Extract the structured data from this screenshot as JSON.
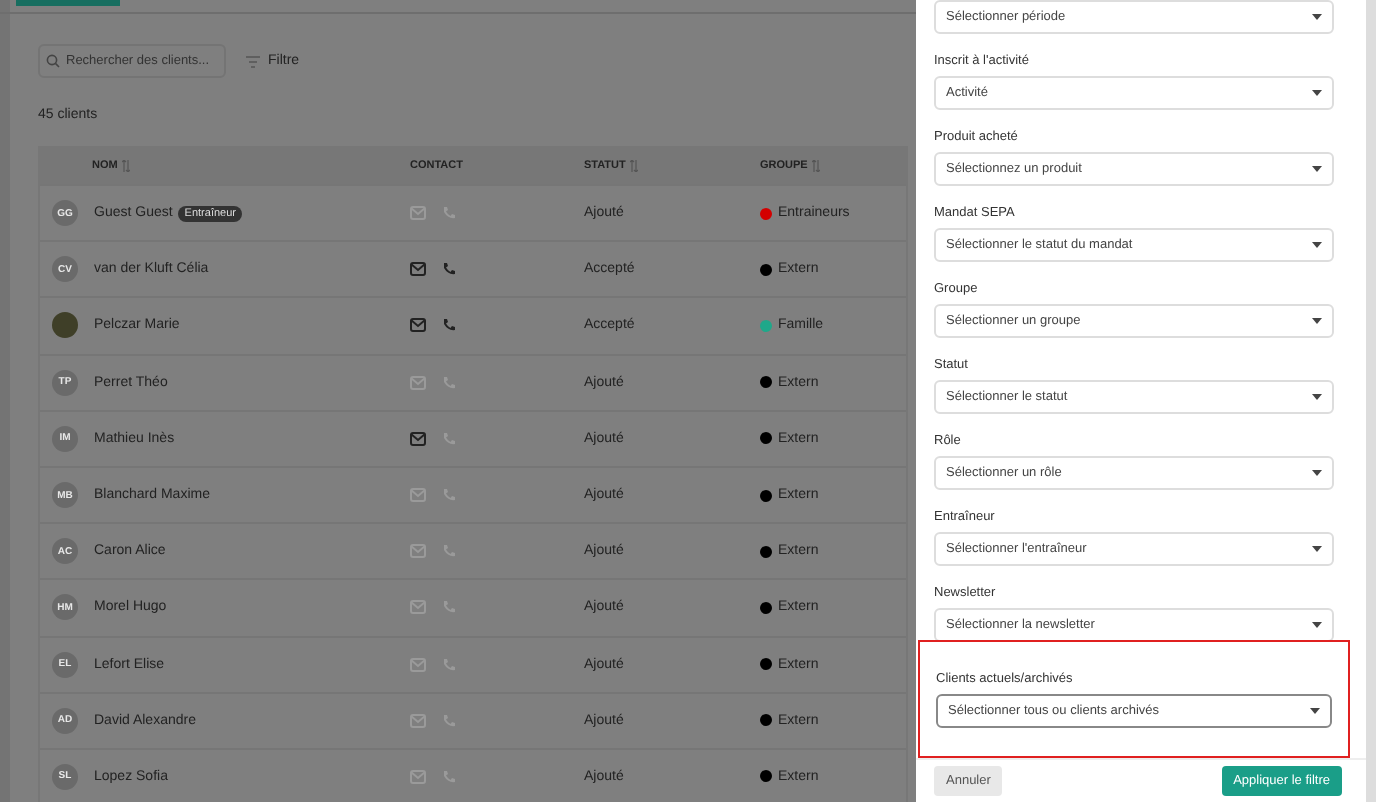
{
  "search": {
    "placeholder": "Rechercher des clients..."
  },
  "filter_button": {
    "label": "Filtre"
  },
  "client_count": "45 clients",
  "table": {
    "columns": [
      {
        "label": "NOM",
        "sortable": true
      },
      {
        "label": "CONTACT",
        "sortable": false
      },
      {
        "label": "STATUT",
        "sortable": true
      },
      {
        "label": "GROUPE",
        "sortable": true
      }
    ],
    "rows": [
      {
        "initials": "GG",
        "photo": false,
        "name": "Guest Guest",
        "badge": "Entraîneur",
        "email": false,
        "phone": false,
        "status": "Ajouté",
        "group": "Entraineurs",
        "color": "#d40000"
      },
      {
        "initials": "CV",
        "photo": false,
        "name": "van der Kluft Célia",
        "email": true,
        "phone": true,
        "status": "Accepté",
        "group": "Extern",
        "color": "#000000"
      },
      {
        "photo": true,
        "name": "Pelczar Marie",
        "email": true,
        "phone": true,
        "status": "Accepté",
        "group": "Famille",
        "color": "#1fa88a"
      },
      {
        "initials": "TP",
        "photo": false,
        "name": "Perret Théo",
        "email": false,
        "phone": false,
        "status": "Ajouté",
        "group": "Extern",
        "color": "#000000"
      },
      {
        "initials": "IM",
        "photo": false,
        "name": "Mathieu Inès",
        "email": true,
        "phone": false,
        "status": "Ajouté",
        "group": "Extern",
        "color": "#000000"
      },
      {
        "initials": "MB",
        "photo": false,
        "name": "Blanchard Maxime",
        "email": false,
        "phone": false,
        "status": "Ajouté",
        "group": "Extern",
        "color": "#000000"
      },
      {
        "initials": "AC",
        "photo": false,
        "name": "Caron Alice",
        "email": false,
        "phone": false,
        "status": "Ajouté",
        "group": "Extern",
        "color": "#000000"
      },
      {
        "initials": "HM",
        "photo": false,
        "name": "Morel Hugo",
        "email": false,
        "phone": false,
        "status": "Ajouté",
        "group": "Extern",
        "color": "#000000"
      },
      {
        "initials": "EL",
        "photo": false,
        "name": "Lefort Elise",
        "email": false,
        "phone": false,
        "status": "Ajouté",
        "group": "Extern",
        "color": "#000000"
      },
      {
        "initials": "AD",
        "photo": false,
        "name": "David Alexandre",
        "email": false,
        "phone": false,
        "status": "Ajouté",
        "group": "Extern",
        "color": "#000000"
      },
      {
        "initials": "SL",
        "photo": false,
        "name": "Lopez Sofia",
        "email": false,
        "phone": false,
        "status": "Ajouté",
        "group": "Extern",
        "color": "#000000"
      }
    ]
  },
  "filter_panel": {
    "fields": [
      {
        "value": "Sélectionner période",
        "highlighted": false
      },
      {
        "label": "Inscrit à l'activité",
        "value": "Activité",
        "highlighted": false
      },
      {
        "label": "Produit acheté",
        "value": "Sélectionnez un produit",
        "highlighted": false
      },
      {
        "label": "Mandat SEPA",
        "value": "Sélectionner le statut du mandat",
        "highlighted": false
      },
      {
        "label": "Groupe",
        "value": "Sélectionner un groupe",
        "highlighted": false
      },
      {
        "label": "Statut",
        "value": "Sélectionner le statut",
        "highlighted": false
      },
      {
        "label": "Rôle",
        "value": "Sélectionner un rôle",
        "highlighted": false
      },
      {
        "label": "Entraîneur",
        "value": "Sélectionner l'entraîneur",
        "highlighted": false
      },
      {
        "label": "Newsletter",
        "value": "Sélectionner la newsletter",
        "highlighted": false
      },
      {
        "label": "Clients actuels/archivés",
        "value": "Sélectionner tous ou clients archivés",
        "highlighted": true
      }
    ],
    "cancel": "Annuler",
    "apply": "Appliquer le filtre"
  }
}
